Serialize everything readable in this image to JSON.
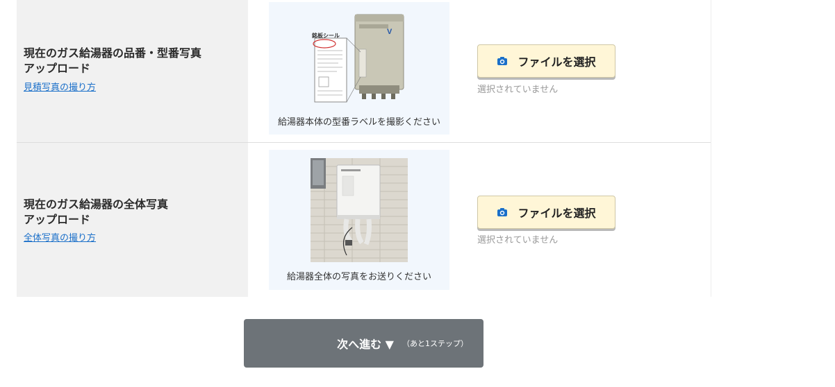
{
  "rows": [
    {
      "title_line1": "現在のガス給湯器の品番・型番写真",
      "title_line2": "アップロード",
      "help_link": "見積写真の撮り方",
      "example_caption": "給湯器本体の型番ラベルを撮影ください",
      "example_label_title": "銘板シール",
      "file_button_label": "ファイルを選択",
      "file_status": "選択されていません"
    },
    {
      "title_line1": "現在のガス給湯器の全体写真",
      "title_line2": "アップロード",
      "help_link": "全体写真の撮り方",
      "example_caption": "給湯器全体の写真をお送りください",
      "file_button_label": "ファイルを選択",
      "file_status": "選択されていません"
    }
  ],
  "next_button": {
    "label": "次へ進む ▼",
    "sub_label": "（あと1ステップ）"
  },
  "colors": {
    "label_bg": "#f1f1f1",
    "example_bg": "#f2f7fd",
    "button_bg": "#fff6d7",
    "link": "#1a6fc9",
    "camera_icon": "#1a6fc9",
    "next_bg": "#6d7378"
  },
  "icons": [
    "camera-icon"
  ]
}
